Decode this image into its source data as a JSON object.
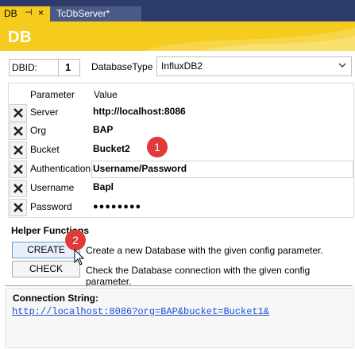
{
  "tabs": [
    {
      "label": "DB",
      "pin": "⊣",
      "close": "×"
    },
    {
      "label": "TcDbServer*"
    }
  ],
  "header": {
    "title": "DB"
  },
  "dbid": {
    "label": "DBID:",
    "value": "1"
  },
  "database_type": {
    "label": "DatabaseType",
    "selected": "InfluxDB2"
  },
  "grid": {
    "columns": [
      "Parameter",
      "Value"
    ],
    "rows": [
      {
        "param": "Server",
        "value": "http://localhost:8086"
      },
      {
        "param": "Org",
        "value": "BAP"
      },
      {
        "param": "Bucket",
        "value": "Bucket2"
      },
      {
        "param": "Authentication",
        "value": "Username/Password"
      },
      {
        "param": "Username",
        "value": "Bapl"
      },
      {
        "param": "Password",
        "value": "●●●●●●●●"
      }
    ]
  },
  "helper": {
    "title": "Helper Functions",
    "create_label": "CREATE",
    "create_desc": "Create a new Database with the given config parameter.",
    "check_label": "CHECK",
    "check_desc": "Check the Database connection with the given config parameter."
  },
  "connection": {
    "label": "Connection String:",
    "value": "http://localhost:8086?org=BAP&bucket=Bucket1&"
  },
  "markers": [
    "1",
    "2"
  ]
}
